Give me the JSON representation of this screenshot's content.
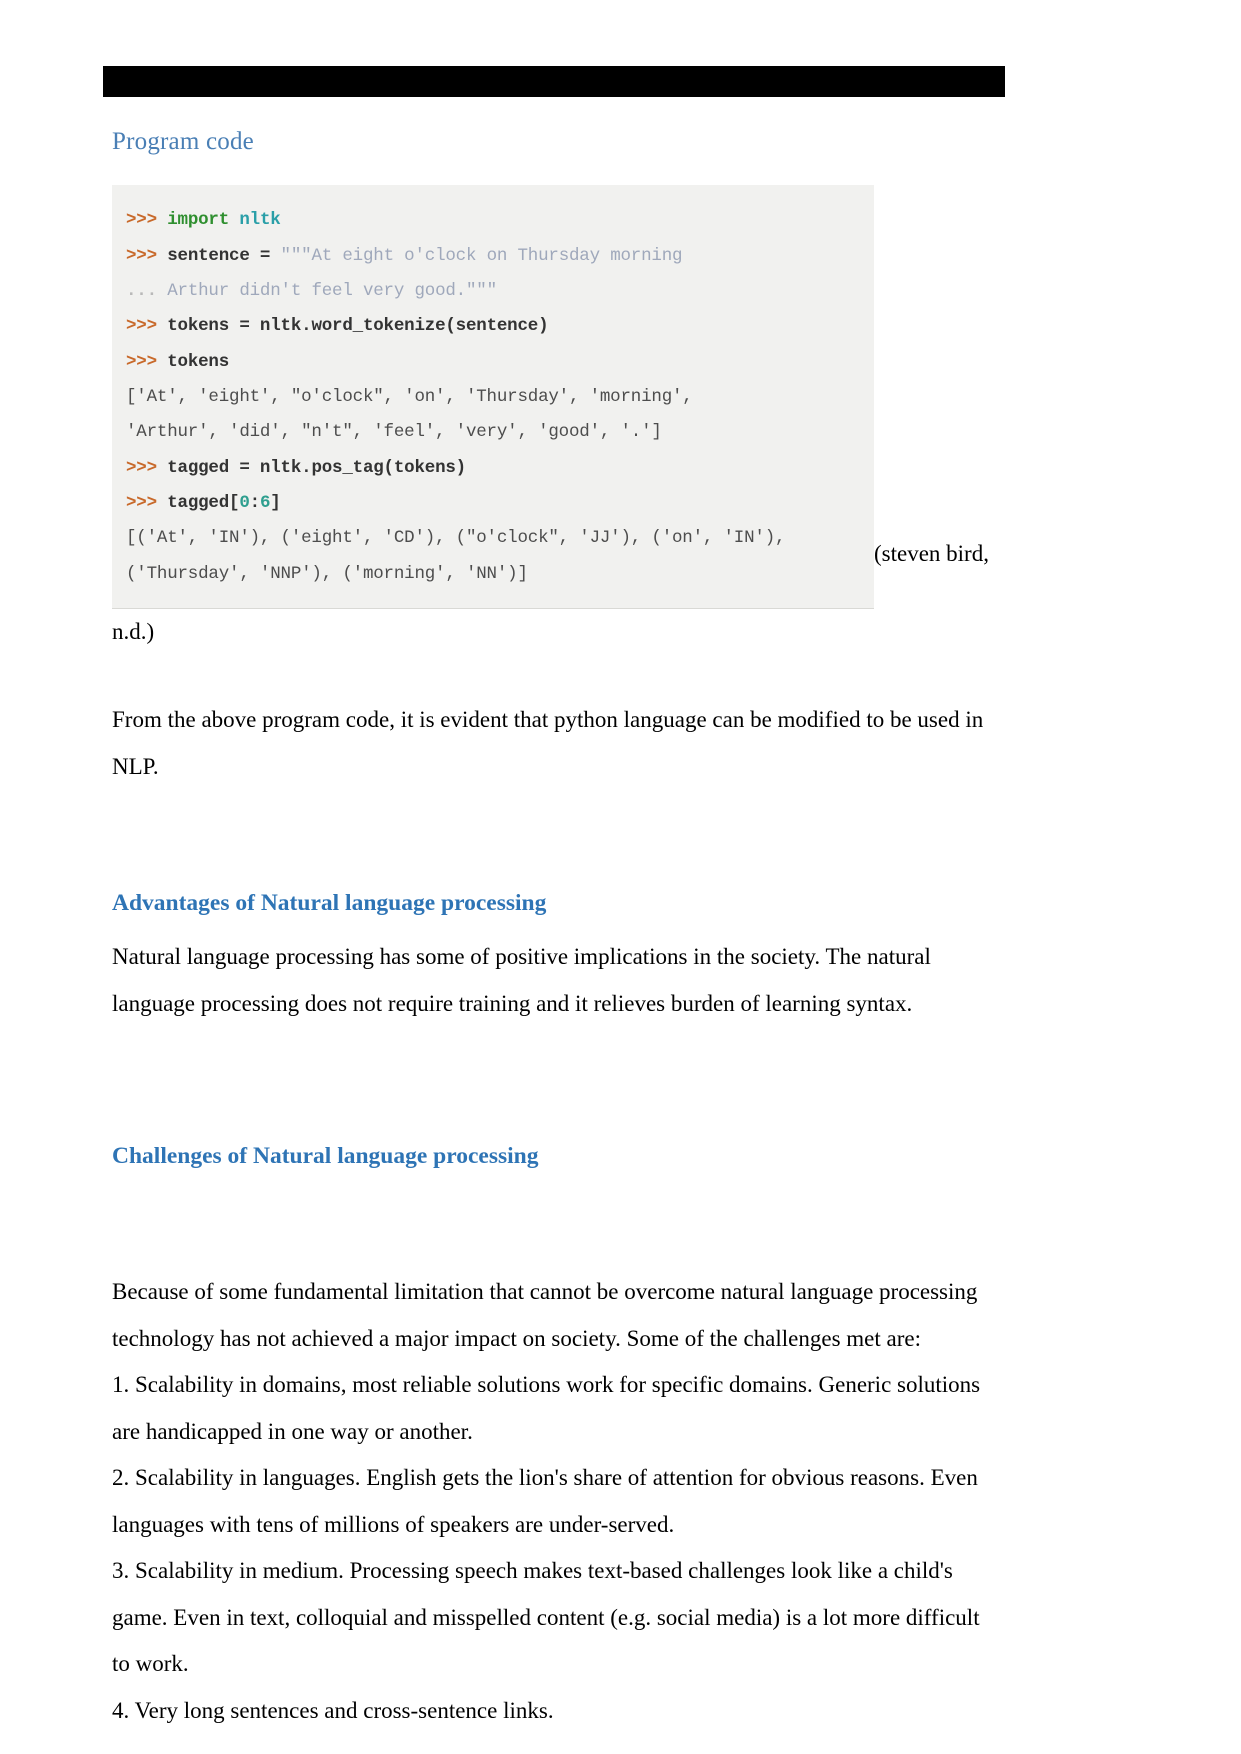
{
  "document": {
    "heading_program_code": "Program code",
    "code_block": {
      "language": "python-repl",
      "lines": [
        [
          {
            "t": ">>> ",
            "c": "prompt"
          },
          {
            "t": "import ",
            "c": "kw"
          },
          {
            "t": "nltk",
            "c": "mod"
          }
        ],
        [
          {
            "t": ">>> ",
            "c": "prompt"
          },
          {
            "t": "sentence = ",
            "c": "code"
          },
          {
            "t": "\"\"\"At eight o'clock on Thursday morning",
            "c": "str"
          }
        ],
        [
          {
            "t": "... ",
            "c": "dots"
          },
          {
            "t": "Arthur didn't feel very good.\"\"\"",
            "c": "str"
          }
        ],
        [
          {
            "t": ">>> ",
            "c": "prompt"
          },
          {
            "t": "tokens = nltk.word_tokenize(sentence)",
            "c": "code"
          }
        ],
        [
          {
            "t": ">>> ",
            "c": "prompt"
          },
          {
            "t": "tokens",
            "c": "code"
          }
        ],
        [
          {
            "t": "['At', 'eight', \"o'clock\", 'on', 'Thursday', 'morning',",
            "c": "out"
          }
        ],
        [
          {
            "t": "'Arthur', 'did', \"n't\", 'feel', 'very', 'good', '.']",
            "c": "out"
          }
        ],
        [
          {
            "t": ">>> ",
            "c": "prompt"
          },
          {
            "t": "tagged = nltk.pos_tag(tokens)",
            "c": "code"
          }
        ],
        [
          {
            "t": ">>> ",
            "c": "prompt"
          },
          {
            "t": "tagged[",
            "c": "code"
          },
          {
            "t": "0",
            "c": "num"
          },
          {
            "t": ":",
            "c": "code"
          },
          {
            "t": "6",
            "c": "num"
          },
          {
            "t": "]",
            "c": "code"
          }
        ],
        [
          {
            "t": "[('At', 'IN'), ('eight', 'CD'), (\"o'clock\", 'JJ'), ('on', 'IN'),",
            "c": "out"
          }
        ],
        [
          {
            "t": "('Thursday', 'NNP'), ('morning', 'NN')]",
            "c": "out"
          }
        ]
      ]
    },
    "citation_head": "(steven bird,",
    "citation_tail": "n.d.)",
    "paragraph_from_above": "From the above program code, it is evident that python language can be modified to be used in NLP.",
    "heading_advantages": "Advantages of Natural language processing",
    "paragraph_advantages": "Natural language processing has some of positive implications in the society. The natural language processing does not require training and it relieves burden of learning syntax.",
    "heading_challenges": "Challenges of Natural language processing",
    "paragraph_challenges_intro": "Because of some fundamental limitation that cannot be overcome natural language processing technology has not achieved a major impact on society. Some of the challenges met are:",
    "challenges_list": [
      "1. Scalability in domains, most reliable solutions work for specific domains. Generic solutions are handicapped in one way or another.",
      "2. Scalability in languages. English gets the lion's share of attention for obvious reasons. Even languages with tens of millions of speakers are under-served.",
      "3. Scalability in medium. Processing speech makes text-based challenges look like a child's game. Even in text, colloquial and misspelled content (e.g. social media) is a lot more difficult to work.",
      "4. Very long sentences and cross-sentence links."
    ]
  },
  "colors": {
    "heading_blue": "#2e74b5",
    "program_code_blue": "#4a7fb5",
    "code_background": "#f1f1ef",
    "prompt_orange": "#c8692a",
    "keyword_green": "#2f8f2f",
    "module_teal": "#2a9fa8",
    "string_gray_blue": "#9fa8bb",
    "number_teal": "#2f9f8f",
    "header_bar": "#000000"
  }
}
